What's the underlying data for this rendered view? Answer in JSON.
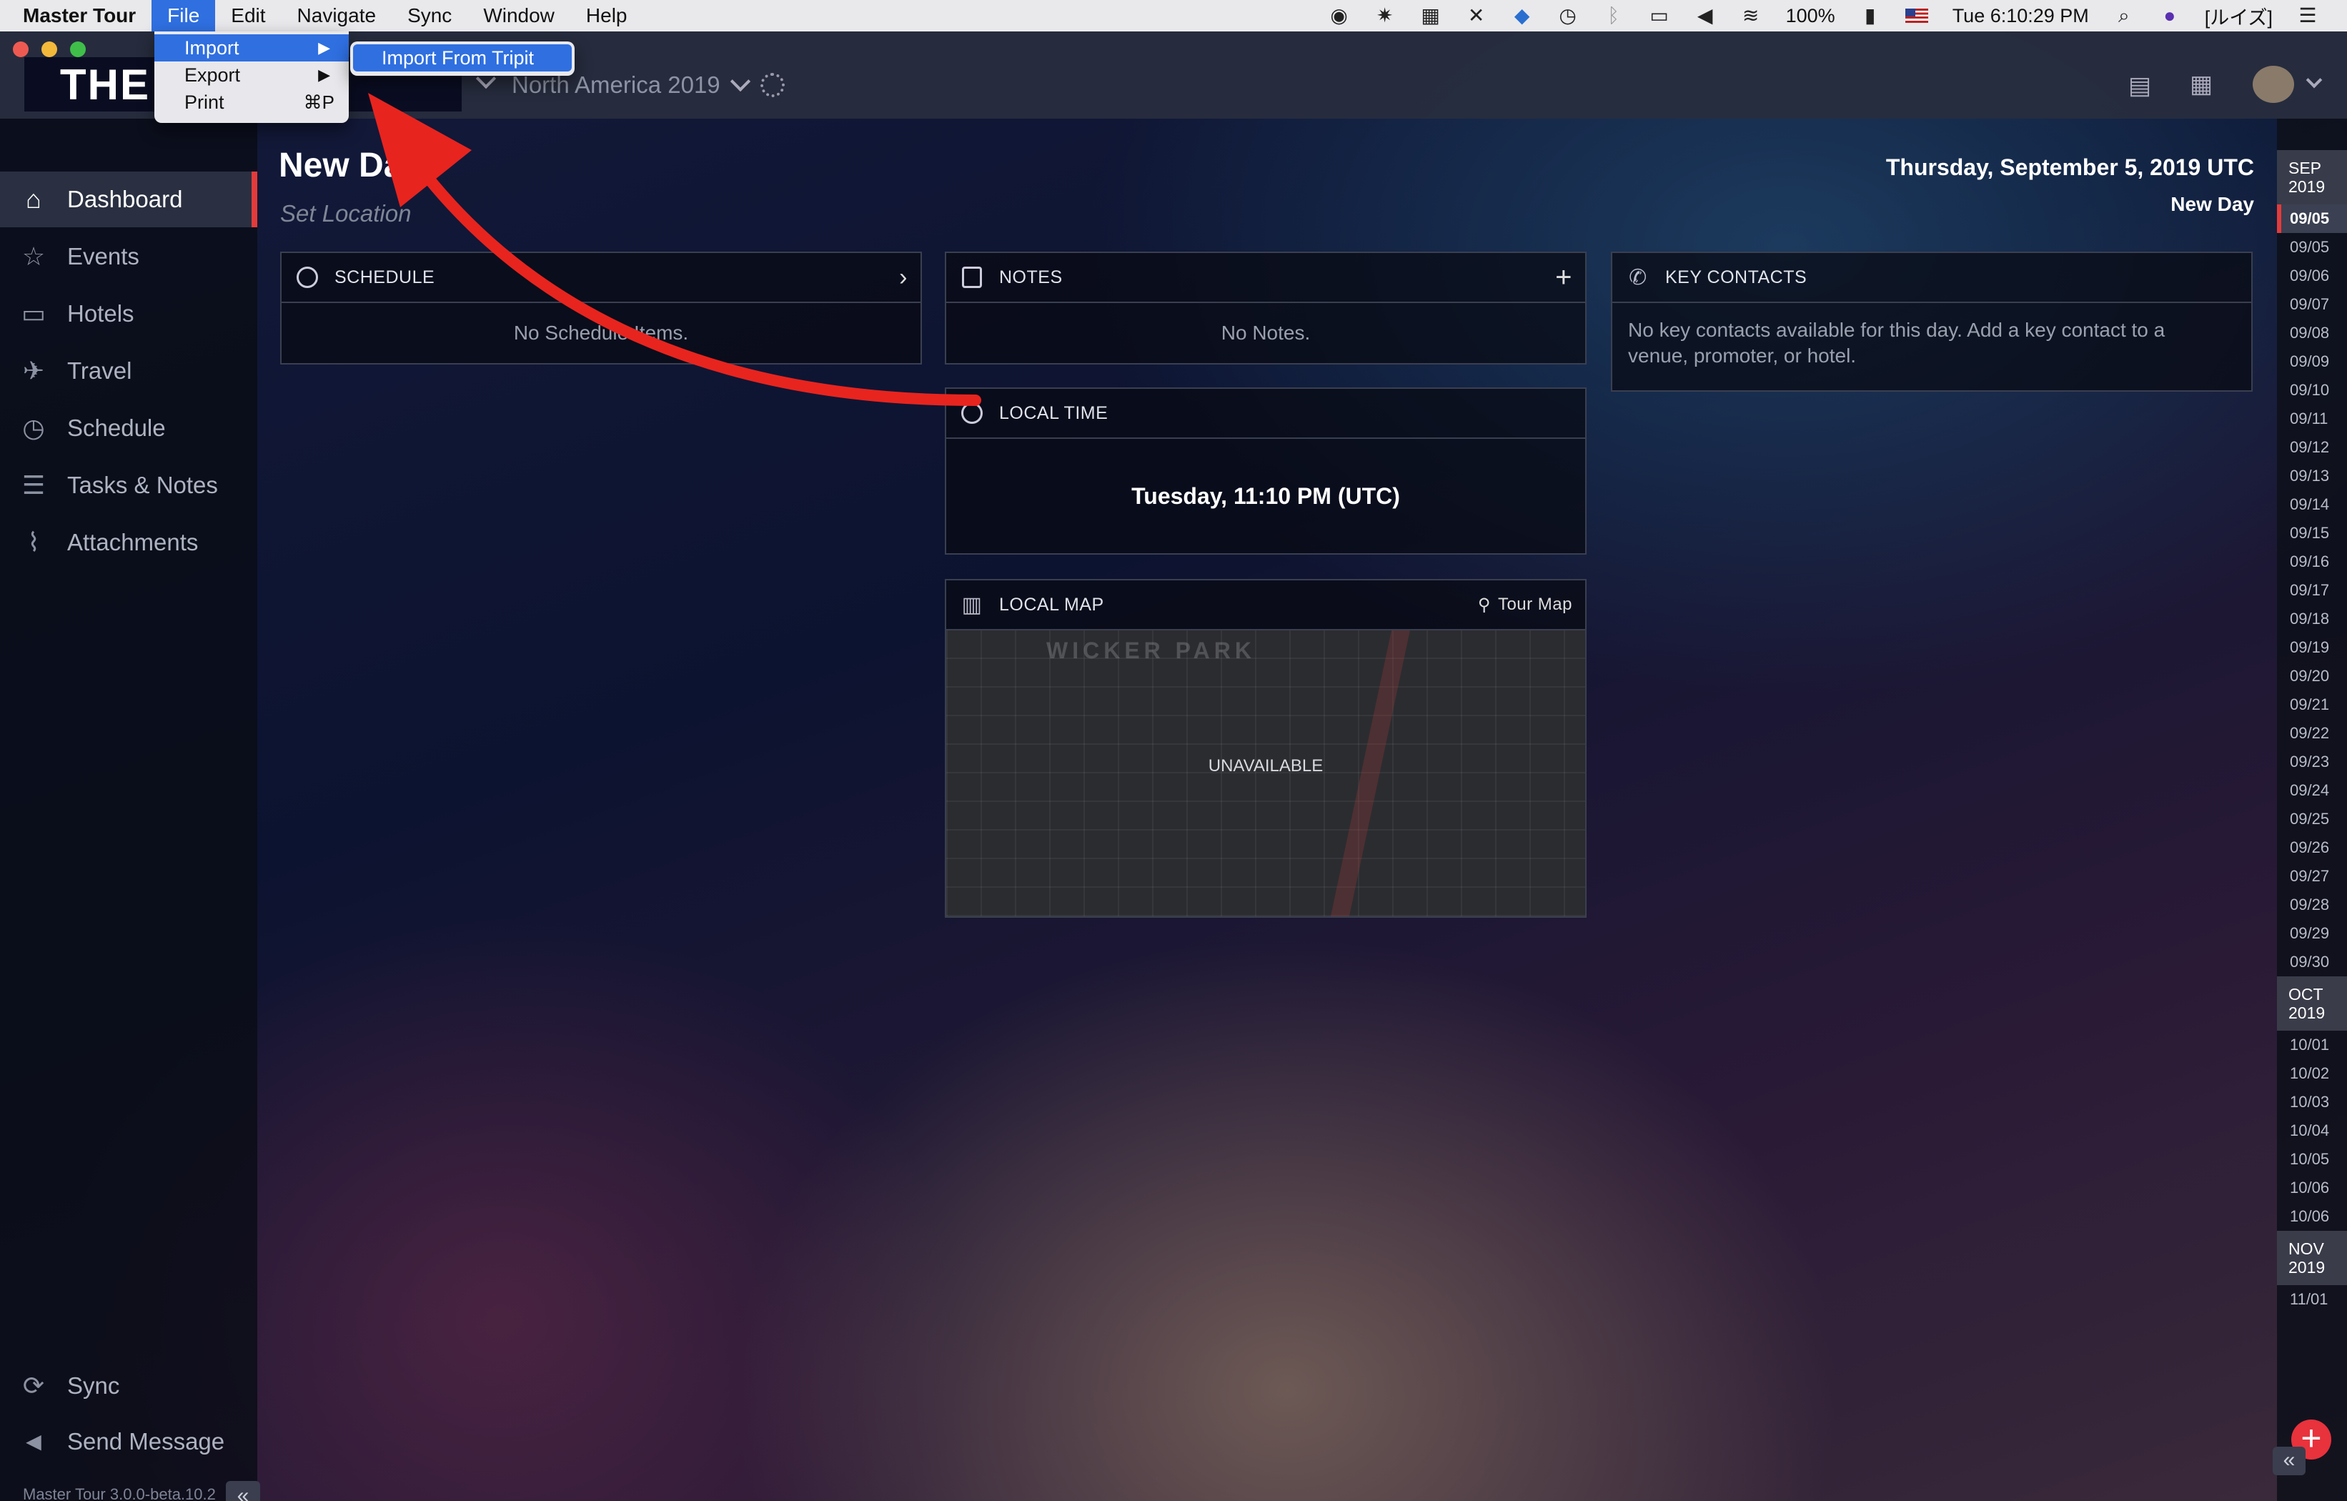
{
  "menubar": {
    "app_name": "Master Tour",
    "items": [
      "File",
      "Edit",
      "Navigate",
      "Sync",
      "Window",
      "Help"
    ],
    "active_item": "File",
    "status": {
      "battery": "100%",
      "clock": "Tue 6:10:29 PM",
      "input_method": "[ルイズ]"
    }
  },
  "file_menu": {
    "items": [
      {
        "label": "Import",
        "arrow": "▶",
        "shortcut": ""
      },
      {
        "label": "Export",
        "arrow": "▶",
        "shortcut": ""
      },
      {
        "label": "Print",
        "arrow": "",
        "shortcut": "⌘P"
      }
    ],
    "submenu": {
      "items": [
        "Import From Tripit"
      ]
    }
  },
  "titlebar": {
    "logo_text": "THE  ERS",
    "tour_name": "North America 2019"
  },
  "sidebar": {
    "items": [
      {
        "label": "Dashboard",
        "icon": "home-icon",
        "selected": true
      },
      {
        "label": "Events",
        "icon": "star-icon",
        "selected": false
      },
      {
        "label": "Hotels",
        "icon": "bed-icon",
        "selected": false
      },
      {
        "label": "Travel",
        "icon": "plane-icon",
        "selected": false
      },
      {
        "label": "Schedule",
        "icon": "clock-icon",
        "selected": false
      },
      {
        "label": "Tasks & Notes",
        "icon": "list-icon",
        "selected": false
      },
      {
        "label": "Attachments",
        "icon": "paperclip-icon",
        "selected": false
      }
    ],
    "bottom": [
      {
        "label": "Sync",
        "icon": "sync-icon"
      },
      {
        "label": "Send Message",
        "icon": "megaphone-icon"
      }
    ],
    "version": "Master Tour 3.0.0-beta.10.2"
  },
  "main": {
    "day_title": "New Day",
    "set_location": "Set Location",
    "date_full": "Thursday, September 5, 2019 UTC",
    "date_sub": "New Day",
    "cards": {
      "schedule": {
        "title": "SCHEDULE",
        "empty": "No Schedule Items."
      },
      "notes": {
        "title": "NOTES",
        "empty": "No Notes."
      },
      "key_contacts": {
        "title": "KEY CONTACTS",
        "empty": "No key contacts available for this day. Add a key contact to a venue, promoter, or hotel."
      },
      "local_time": {
        "title": "LOCAL TIME",
        "value": "Tuesday, 11:10 PM (UTC)"
      },
      "local_map": {
        "title": "LOCAL MAP",
        "link": "Tour Map",
        "status": "UNAVAILABLE",
        "map_label": "WICKER PARK"
      }
    }
  },
  "date_rail": {
    "months": [
      {
        "label": "SEP",
        "year": "2019",
        "dates": [
          "09/05",
          "09/05",
          "09/06",
          "09/07",
          "09/08",
          "09/09",
          "09/10",
          "09/11",
          "09/12",
          "09/13",
          "09/14",
          "09/15",
          "09/16",
          "09/17",
          "09/18",
          "09/19",
          "09/20",
          "09/21",
          "09/22",
          "09/23",
          "09/24",
          "09/25",
          "09/26",
          "09/27",
          "09/28",
          "09/29",
          "09/30"
        ]
      },
      {
        "label": "OCT",
        "year": "2019",
        "dates": [
          "10/01",
          "10/02",
          "10/03",
          "10/04",
          "10/05",
          "10/06",
          "10/06"
        ]
      },
      {
        "label": "NOV",
        "year": "2019",
        "dates": [
          "11/01"
        ]
      }
    ],
    "add_symbol": "+"
  },
  "colors": {
    "accent_red": "#e33b3b",
    "menu_highlight": "#2f6fe0"
  }
}
